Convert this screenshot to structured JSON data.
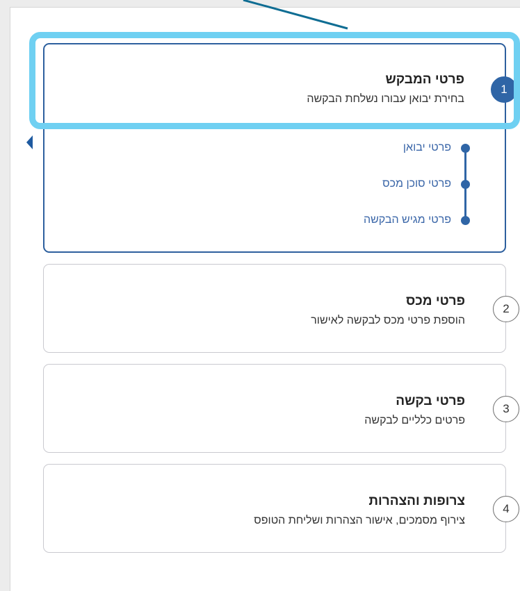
{
  "steps": [
    {
      "number": "1",
      "title": "פרטי המבקש",
      "subtitle": "בחירת יבואן עבורו נשלחת הבקשה",
      "active": true,
      "substeps": [
        "פרטי יבואן",
        "פרטי סוכן מכס",
        "פרטי מגיש הבקשה"
      ]
    },
    {
      "number": "2",
      "title": "פרטי מכס",
      "subtitle": "הוספת פרטי מכס לבקשה לאישור"
    },
    {
      "number": "3",
      "title": "פרטי בקשה",
      "subtitle": "פרטים כלליים לבקשה"
    },
    {
      "number": "4",
      "title": "צרופות והצהרות",
      "subtitle": "צירוף מסמכים, אישור הצהרות ושליחת הטופס"
    }
  ],
  "colors": {
    "accent": "#2f65a6",
    "highlight": "#6fd0f2",
    "sublink": "#3a66a8",
    "border": "#c9c9cf"
  }
}
